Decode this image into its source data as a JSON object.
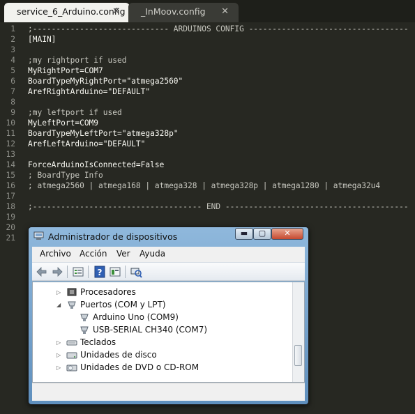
{
  "tabs": [
    {
      "label": "service_6_Arduino.config",
      "close": "✕",
      "active": true
    },
    {
      "label": "_InMoov.config",
      "close": "✕",
      "active": false
    }
  ],
  "editor": {
    "lines": [
      {
        "num": "1",
        "text": ";----------------------------- ARDUINOS CONFIG ----------------------------------",
        "kind": "comment"
      },
      {
        "num": "2",
        "text": "[MAIN]",
        "kind": "code"
      },
      {
        "num": "3",
        "text": "",
        "kind": "code"
      },
      {
        "num": "4",
        "text": ";my rightport if used",
        "kind": "comment"
      },
      {
        "num": "5",
        "text": "MyRightPort=COM7",
        "kind": "code"
      },
      {
        "num": "6",
        "text": "BoardTypeMyRightPort=\"atmega2560\"",
        "kind": "code"
      },
      {
        "num": "7",
        "text": "ArefRightArduino=\"DEFAULT\"",
        "kind": "code"
      },
      {
        "num": "8",
        "text": "",
        "kind": "code"
      },
      {
        "num": "9",
        "text": ";my leftport if used",
        "kind": "comment"
      },
      {
        "num": "10",
        "text": "MyLeftPort=COM9",
        "kind": "code"
      },
      {
        "num": "11",
        "text": "BoardTypeMyLeftPort=\"atmega328p\"",
        "kind": "code"
      },
      {
        "num": "12",
        "text": "ArefLeftArduino=\"DEFAULT\"",
        "kind": "code"
      },
      {
        "num": "13",
        "text": "",
        "kind": "code"
      },
      {
        "num": "14",
        "text": "ForceArduinoIsConnected=False",
        "kind": "code"
      },
      {
        "num": "15",
        "text": "; BoardType Info",
        "kind": "comment"
      },
      {
        "num": "16",
        "text": "; atmega2560 | atmega168 | atmega328 | atmega328p | atmega1280 | atmega32u4",
        "kind": "comment"
      },
      {
        "num": "17",
        "text": "",
        "kind": "code"
      },
      {
        "num": "18",
        "text": ";------------------------------------ END ---------------------------------------",
        "kind": "comment"
      },
      {
        "num": "19",
        "text": "",
        "kind": "code"
      },
      {
        "num": "20",
        "text": "",
        "kind": "code"
      },
      {
        "num": "21",
        "text": "",
        "kind": "code"
      }
    ]
  },
  "device_manager": {
    "title": "Administrador de dispositivos",
    "window_buttons": {
      "minimize": "▬",
      "maximize": "▢",
      "close": "✕"
    },
    "menu": [
      "Archivo",
      "Acción",
      "Ver",
      "Ayuda"
    ],
    "toolbar_icons": [
      "back-arrow-icon",
      "forward-arrow-icon",
      "properties-icon",
      "help-icon",
      "update-driver-icon",
      "scan-hardware-icon"
    ],
    "tree": [
      {
        "label": "Procesadores",
        "level": 0,
        "expander": "▷",
        "icon": "processor-icon"
      },
      {
        "label": "Puertos (COM y LPT)",
        "level": 0,
        "expander": "◢",
        "icon": "port-icon"
      },
      {
        "label": "Arduino Uno (COM9)",
        "level": 1,
        "expander": "",
        "icon": "port-icon"
      },
      {
        "label": "USB-SERIAL CH340 (COM7)",
        "level": 1,
        "expander": "",
        "icon": "port-icon"
      },
      {
        "label": "Teclados",
        "level": 0,
        "expander": "▷",
        "icon": "keyboard-icon"
      },
      {
        "label": "Unidades de disco",
        "level": 0,
        "expander": "▷",
        "icon": "disk-drive-icon"
      },
      {
        "label": "Unidades de DVD o CD-ROM",
        "level": 0,
        "expander": "▷",
        "icon": "dvd-drive-icon"
      }
    ]
  },
  "colors": {
    "editor_bg": "#272822",
    "editor_text": "#f8f8f2",
    "gutter_text": "#8f908a",
    "titlebar": "#8fb8dc"
  }
}
